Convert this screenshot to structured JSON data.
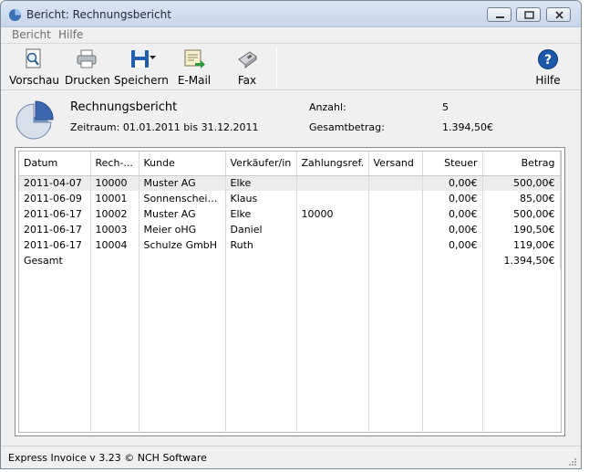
{
  "window": {
    "title": "Bericht: Rechnungsbericht"
  },
  "menu": {
    "items": [
      "Bericht",
      "Hilfe"
    ]
  },
  "toolbar": {
    "vorschau": "Vorschau",
    "drucken": "Drucken",
    "speichern": "Speichern",
    "email": "E-Mail",
    "fax": "Fax",
    "hilfe": "Hilfe"
  },
  "report": {
    "title": "Rechnungsbericht",
    "range": "Zeitraum: 01.01.2011 bis 31.12.2011",
    "count_label": "Anzahl:",
    "count_value": "5",
    "total_label": "Gesamtbetrag:",
    "total_value": "1.394,50€"
  },
  "table": {
    "headers": [
      "Datum",
      "Rech-...",
      "Kunde",
      "Verkäufer/in",
      "Zahlungsref.",
      "Versand",
      "Steuer",
      "Betrag"
    ],
    "rows": [
      [
        "2011-04-07",
        "10000",
        "Muster AG",
        "Elke",
        "",
        "",
        "0,00€",
        "500,00€"
      ],
      [
        "2011-06-09",
        "10001",
        "Sonnenschein ...",
        "Klaus",
        "",
        "",
        "0,00€",
        "85,00€"
      ],
      [
        "2011-06-17",
        "10002",
        "Muster AG",
        "Elke",
        "10000",
        "",
        "0,00€",
        "500,00€"
      ],
      [
        "2011-06-17",
        "10003",
        "Meier oHG",
        "Daniel",
        "",
        "",
        "0,00€",
        "190,50€"
      ],
      [
        "2011-06-17",
        "10004",
        "Schulze GmbH",
        "Ruth",
        "",
        "",
        "0,00€",
        "119,00€"
      ],
      [
        "Gesamt",
        "",
        "",
        "",
        "",
        "",
        "",
        "1.394,50€"
      ]
    ]
  },
  "status": {
    "text": "Express Invoice v 3.23 © NCH Software"
  },
  "colors": {
    "title_bar": "#c6d6ea",
    "accent": "#1a5fb4",
    "selected_row": "#ececec"
  }
}
